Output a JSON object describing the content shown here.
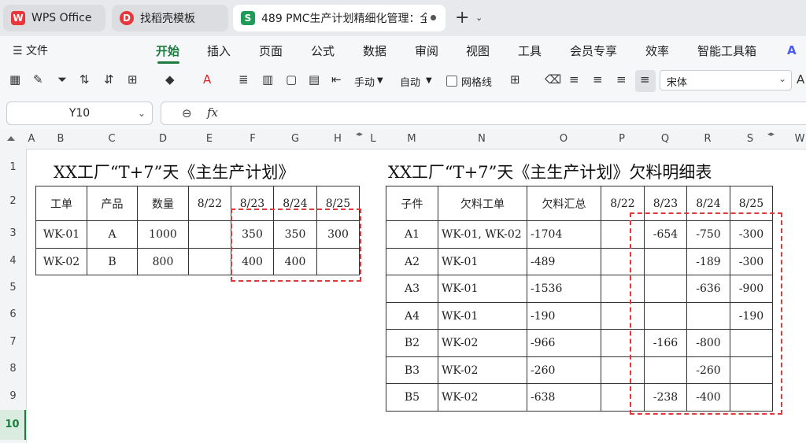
{
  "tabs": {
    "wps_label": "WPS Office",
    "template_label": "找稻壳模板",
    "active_label": "489 PMC生产计划精细化管理：全",
    "new_tab": "+",
    "new_tab_menu": "⌄"
  },
  "menu": {
    "file_label": "文件",
    "items": [
      "开始",
      "插入",
      "页面",
      "公式",
      "数据",
      "审阅",
      "视图",
      "工具",
      "会员专享",
      "效率",
      "智能工具箱"
    ],
    "active": "开始"
  },
  "toolbar": {
    "manual_label": "手动",
    "auto_label": "自动",
    "gridlines_label": "网格线",
    "font_name": "宋体",
    "gridlines_checked": false
  },
  "formula": {
    "cell_ref": "Y10",
    "fx_label": "fx",
    "content": ""
  },
  "columns": [
    "A",
    "B",
    "C",
    "D",
    "E",
    "F",
    "G",
    "H",
    "L",
    "M",
    "N",
    "O",
    "P",
    "Q",
    "R",
    "S",
    "W"
  ],
  "rows": [
    "1",
    "2",
    "3",
    "4",
    "5",
    "6",
    "7",
    "8",
    "9",
    "10"
  ],
  "selected_row": "10",
  "sheet": {
    "left_title": "XX工厂“T+7”天《主生产计划》",
    "right_title": "XX工厂“T+7”天《主生产计划》欠料明细表",
    "plan": {
      "headers": [
        "工单",
        "产品",
        "数量",
        "8/22",
        "8/23",
        "8/24",
        "8/25"
      ],
      "rows": [
        [
          "WK-01",
          "A",
          "1000",
          "",
          "350",
          "350",
          "300"
        ],
        [
          "WK-02",
          "B",
          "800",
          "",
          "400",
          "400",
          ""
        ]
      ]
    },
    "shortage": {
      "headers": [
        "子件",
        "欠料工单",
        "欠料汇总",
        "8/22",
        "8/23",
        "8/24",
        "8/25"
      ],
      "rows": [
        [
          "A1",
          "WK-01, WK-02",
          "-1704",
          "",
          "-654",
          "-750",
          "-300"
        ],
        [
          "A2",
          "WK-01",
          "-489",
          "",
          "",
          "-189",
          "-300"
        ],
        [
          "A3",
          "WK-01",
          "-1536",
          "",
          "",
          "-636",
          "-900"
        ],
        [
          "A4",
          "WK-01",
          "-190",
          "",
          "",
          "",
          "-190"
        ],
        [
          "B2",
          "WK-02",
          "-966",
          "",
          "-166",
          "-800",
          ""
        ],
        [
          "B3",
          "WK-02",
          "-260",
          "",
          "",
          "-260",
          ""
        ],
        [
          "B5",
          "WK-02",
          "-638",
          "",
          "-238",
          "-400",
          ""
        ]
      ]
    }
  },
  "colors": {
    "accent": "#1c7c3f",
    "highlight_dash": "#e0383b"
  }
}
